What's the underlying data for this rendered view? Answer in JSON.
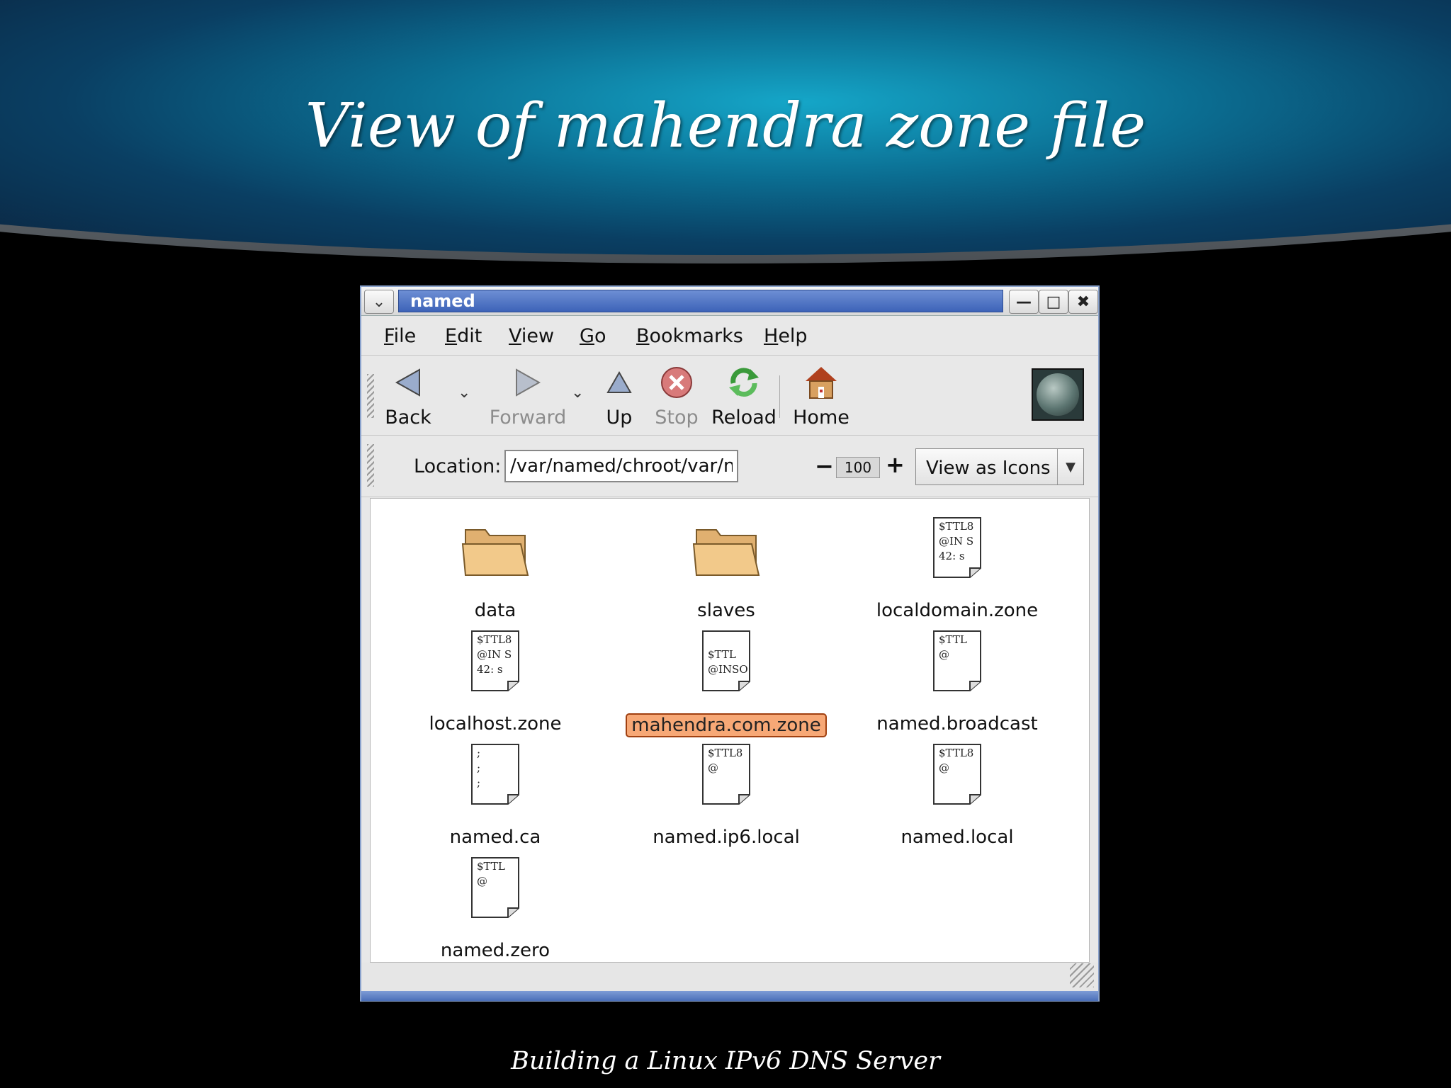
{
  "slide": {
    "title": "View of mahendra zone file",
    "footer": "Building a Linux IPv6 DNS Server"
  },
  "window": {
    "title": "named",
    "menu": [
      {
        "label_u": "F",
        "label_rest": "ile"
      },
      {
        "label_u": "E",
        "label_rest": "dit"
      },
      {
        "label_u": "V",
        "label_rest": "iew"
      },
      {
        "label_u": "G",
        "label_rest": "o"
      },
      {
        "label_u": "B",
        "label_rest": "ookmarks"
      },
      {
        "label_u": "H",
        "label_rest": "elp"
      }
    ],
    "toolbar": {
      "back": "Back",
      "forward": "Forward",
      "up": "Up",
      "stop": "Stop",
      "reload": "Reload",
      "home": "Home"
    },
    "location": {
      "label": "Location:",
      "value": "/var/named/chroot/var/named",
      "zoom": "100",
      "view_mode": "View as Icons"
    },
    "files": [
      {
        "name": "data",
        "type": "folder",
        "preview": ""
      },
      {
        "name": "slaves",
        "type": "folder",
        "preview": ""
      },
      {
        "name": "localdomain.zone",
        "type": "file",
        "preview": "$TTL8\n@IN S\n42: s"
      },
      {
        "name": "localhost.zone",
        "type": "file",
        "preview": "$TTL8\n@IN S\n42: s"
      },
      {
        "name": "mahendra.com.zone",
        "type": "file",
        "preview": "\n$TTL\n@INSO",
        "selected": true
      },
      {
        "name": "named.broadcast",
        "type": "file",
        "preview": "$TTL\n@"
      },
      {
        "name": "named.ca",
        "type": "file",
        "preview": ";\n;\n;"
      },
      {
        "name": "named.ip6.local",
        "type": "file",
        "preview": "$TTL8\n@"
      },
      {
        "name": "named.local",
        "type": "file",
        "preview": "$TTL8\n@"
      },
      {
        "name": "named.zero",
        "type": "file",
        "preview": "$TTL\n@"
      }
    ],
    "colors": {
      "title_strip": "#3d63b8",
      "selection": "#f7a876",
      "folder": "#f2c98a"
    }
  }
}
